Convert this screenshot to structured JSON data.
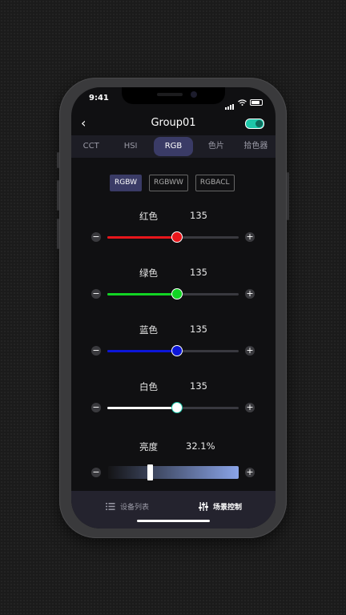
{
  "status_bar": {
    "time": "9:41"
  },
  "nav": {
    "title": "Group01",
    "back_icon": "chevron-left-icon",
    "power_on": true
  },
  "tabs": [
    {
      "label": "CCT",
      "active": false
    },
    {
      "label": "HSI",
      "active": false
    },
    {
      "label": "RGB",
      "active": true
    },
    {
      "label": "色片",
      "active": false
    },
    {
      "label": "拾色器",
      "active": false
    }
  ],
  "modes": [
    {
      "label": "RGBW",
      "active": true
    },
    {
      "label": "RGBWW",
      "active": false
    },
    {
      "label": "RGBACL",
      "active": false
    }
  ],
  "channels": [
    {
      "label": "红色",
      "value": "135",
      "color": "#e8161b",
      "level": 0.53
    },
    {
      "label": "绿色",
      "value": "135",
      "color": "#12d424",
      "level": 0.53
    },
    {
      "label": "蓝色",
      "value": "135",
      "color": "#0c16d8",
      "level": 0.53
    },
    {
      "label": "白色",
      "value": "135",
      "color": "#ffffff",
      "level": 0.53
    }
  ],
  "brightness": {
    "label": "亮度",
    "value": "32.1%",
    "level": 0.321
  },
  "controls": {
    "minus": "−",
    "plus": "+"
  },
  "bottom_nav": [
    {
      "label": "设备列表",
      "icon": "list-icon",
      "active": false
    },
    {
      "label": "场景控制",
      "icon": "sliders-icon",
      "active": true
    }
  ]
}
